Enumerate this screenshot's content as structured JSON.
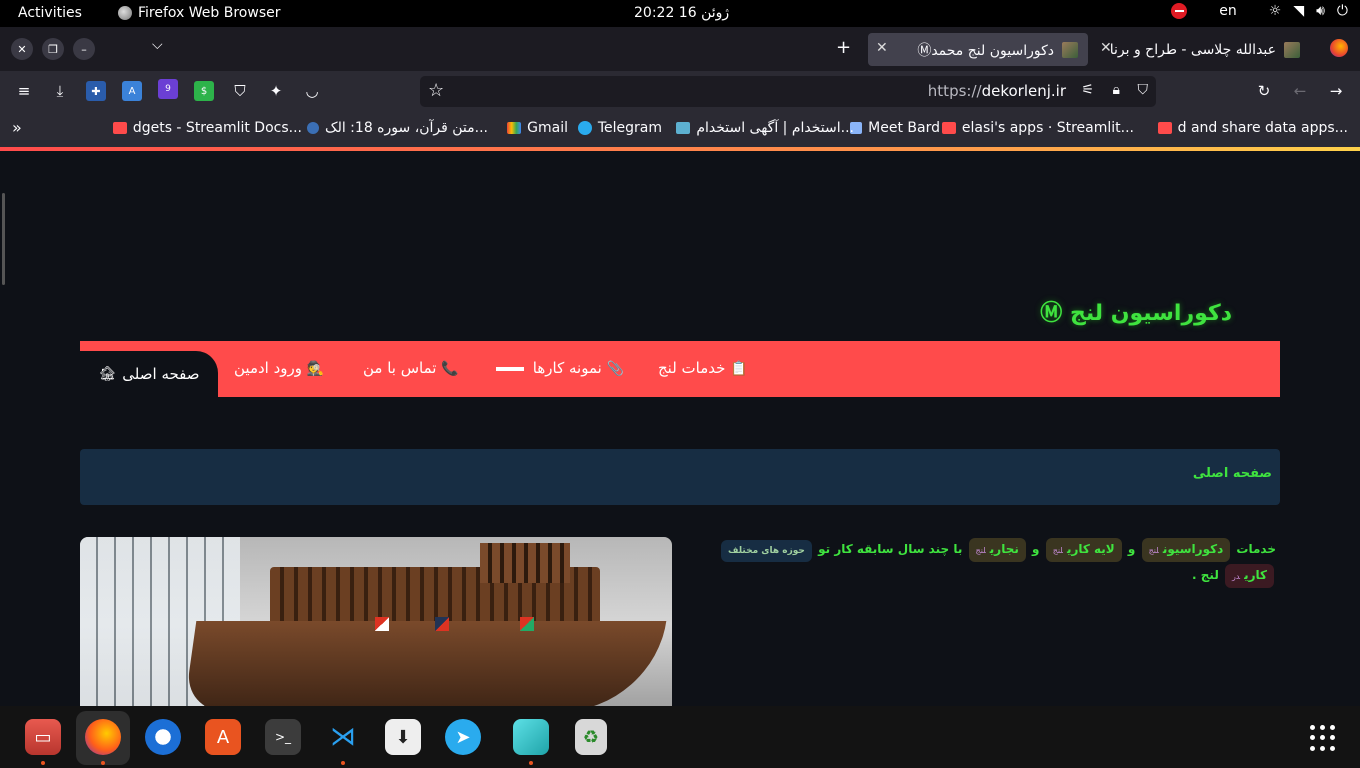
{
  "topbar": {
    "activities": "Activities",
    "app_name": "Firefox Web Browser",
    "clock": "20:22  16 ژوئن",
    "lang": "en"
  },
  "tabs": [
    {
      "title": "دکوراسیون لنج محمدⓂ",
      "active": true
    },
    {
      "title": "عبدالله چلاسی - طراح و برنا",
      "active": false
    }
  ],
  "nav": {
    "url_prefix": "https://",
    "url_domain": "dekorlenj.ir",
    "addon_badge": "9"
  },
  "bookmarks": [
    {
      "label": "d and share data apps...",
      "icon_color": "#ff4b4b"
    },
    {
      "label": "elasi's apps · Streamlit...",
      "icon_color": "#ff4b4b"
    },
    {
      "label": "Meet Bard",
      "icon_color": "#8ab4f8"
    },
    {
      "label": "استخدام | آگهی استخدام...",
      "icon_color": "#5db0d0"
    },
    {
      "label": "Telegram",
      "icon_color": "#2aabee"
    },
    {
      "label": "Gmail",
      "icon_color": "#ea4335"
    },
    {
      "label": "متن قرآن، سوره 18: الک...",
      "icon_color": "#3b6fb5"
    },
    {
      "label": "dgets - Streamlit Docs...",
      "icon_color": "#ff4b4b"
    }
  ],
  "site": {
    "title": "دکوراسیون لنج Ⓜ",
    "menu": [
      {
        "label": "صفحه اصلی",
        "glyph": "🏚",
        "active": true
      },
      {
        "label": "ورود ادمین",
        "glyph": "🕵"
      },
      {
        "label": "تماس با من",
        "glyph": "📞"
      },
      {
        "label": "نمونه کارها",
        "glyph": "📎"
      },
      {
        "label": "خدمات لنج",
        "glyph": "📋"
      }
    ],
    "breadcrumb": "صفحه اصلی",
    "description": {
      "w1": "خدمات",
      "chip1": "دکوراسیون",
      "chip1_small": "لنج",
      "w2": "و",
      "chip2": "لایه کاری",
      "chip2_small": "لنج",
      "w3": "و",
      "chip3": "نجاری",
      "chip3_small": "لنج",
      "w4": "با چند سال سابقه کار",
      "w5": "تو",
      "chip4": "حوزه های مختلف",
      "chip5": "کاری",
      "chip5_small": "در",
      "w6": "لنج ."
    }
  },
  "colors": {
    "accent": "#ff4b4b",
    "green_text": "#3fe33f",
    "page_bg": "#0e1117",
    "breadcrumb_bg": "#172d43"
  },
  "dock": {
    "items": [
      "files-icon",
      "firefox-icon",
      "thunderbird-icon",
      "software-center-icon",
      "terminal-icon",
      "vscode-icon",
      "downloader-icon",
      "telegram-icon",
      "cube-app-icon",
      "trash-icon"
    ]
  }
}
